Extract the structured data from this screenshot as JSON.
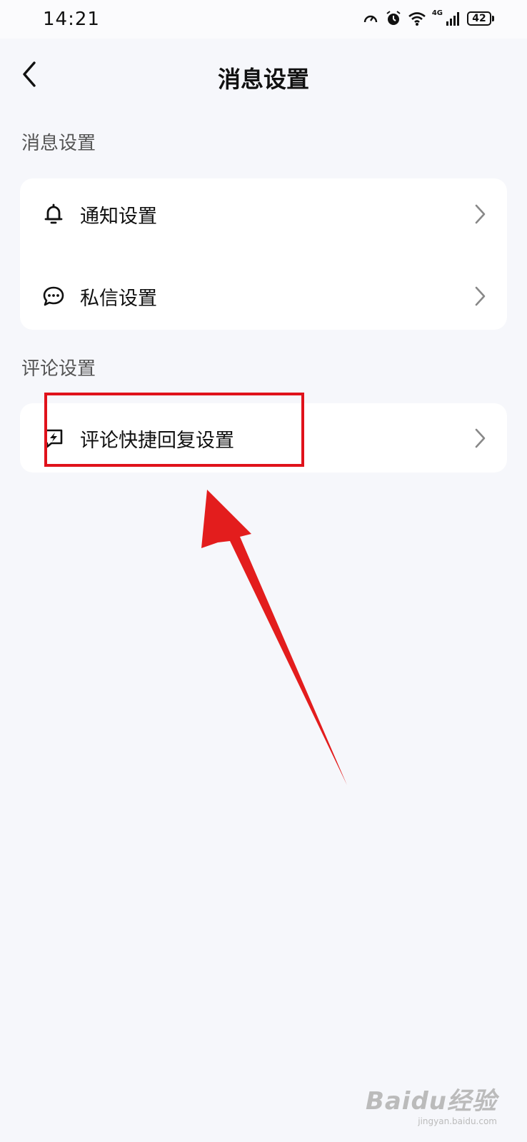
{
  "status_bar": {
    "time": "14:21",
    "network": "4G",
    "battery": "42"
  },
  "header": {
    "title": "消息设置"
  },
  "sections": [
    {
      "label": "消息设置",
      "items": [
        {
          "label": "通知设置"
        },
        {
          "label": "私信设置"
        }
      ]
    },
    {
      "label": "评论设置",
      "items": [
        {
          "label": "评论快捷回复设置"
        }
      ]
    }
  ],
  "annotation": {
    "highlight_color": "#e0121b"
  },
  "watermark": {
    "brand": "Baidu经验",
    "url": "jingyan.baidu.com"
  }
}
